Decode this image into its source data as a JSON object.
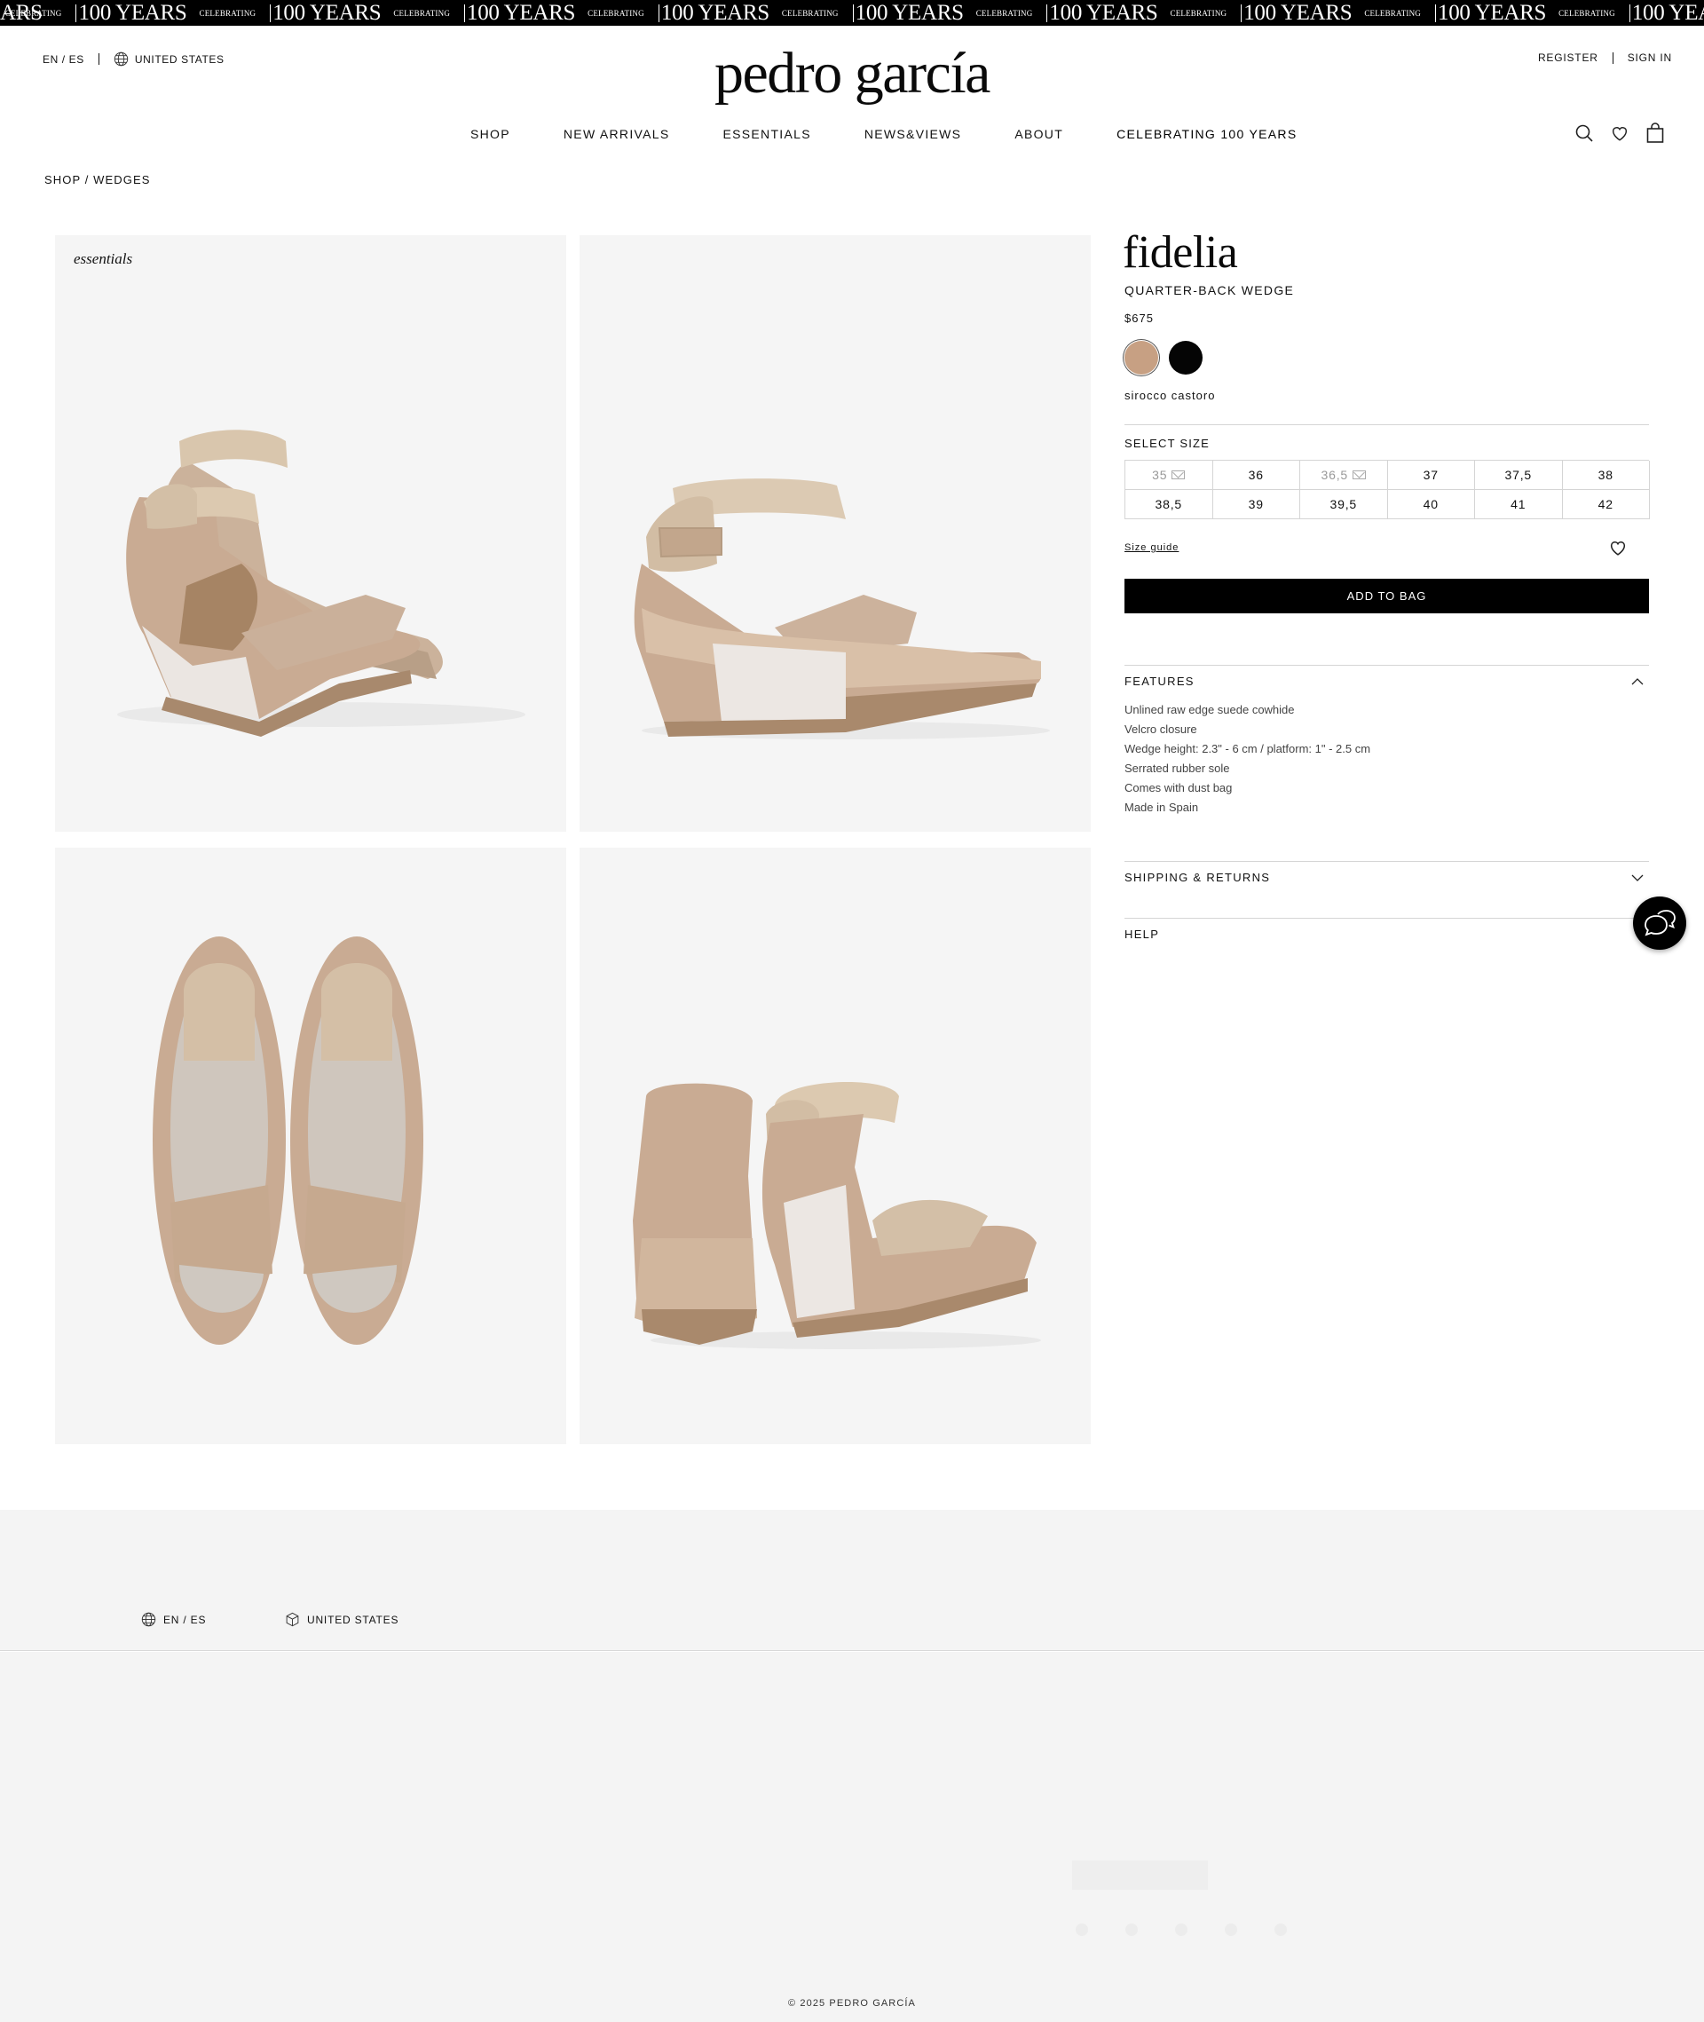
{
  "marquee": {
    "small": "CELEBRATING",
    "big": "100 YEARS",
    "lead": "ARS"
  },
  "header": {
    "language": "EN / ES",
    "country": "UNITED STATES",
    "logo": "pedro garcía",
    "register": "REGISTER",
    "sign_in": "SIGN IN",
    "icons": [
      "search-icon",
      "heart-icon",
      "bag-icon",
      "globe-icon"
    ]
  },
  "nav": [
    "SHOP",
    "NEW ARRIVALS",
    "ESSENTIALS",
    "NEWS&VIEWS",
    "ABOUT",
    "CELEBRATING 100 YEARS"
  ],
  "breadcrumb": "SHOP / WEDGES",
  "gallery": {
    "tag": "essentials",
    "images": [
      "wedge-pair-three-quarter",
      "wedge-side-profile",
      "wedge-top-view",
      "wedge-back-view"
    ]
  },
  "product": {
    "name": "fidelia",
    "subtitle": "QUARTER-BACK WEDGE",
    "price": "$675",
    "swatches": [
      {
        "name": "sirocco castoro",
        "color": "#c7a083",
        "selected": true
      },
      {
        "name": "black",
        "color": "#050505",
        "selected": false
      }
    ],
    "color_name": "sirocco castoro",
    "select_size_label": "SELECT SIZE",
    "sizes": [
      {
        "label": "35",
        "available": false
      },
      {
        "label": "36",
        "available": true
      },
      {
        "label": "36,5",
        "available": false
      },
      {
        "label": "37",
        "available": true
      },
      {
        "label": "37,5",
        "available": true
      },
      {
        "label": "38",
        "available": true
      },
      {
        "label": "38,5",
        "available": true
      },
      {
        "label": "39",
        "available": true
      },
      {
        "label": "39,5",
        "available": true
      },
      {
        "label": "40",
        "available": true
      },
      {
        "label": "41",
        "available": true
      },
      {
        "label": "42",
        "available": true
      }
    ],
    "size_guide": "Size guide",
    "add_to_bag": "ADD TO BAG"
  },
  "accordions": {
    "features": {
      "title": "FEATURES",
      "items": [
        "Unlined raw edge suede cowhide",
        "Velcro closure",
        "Wedge height: 2.3\" - 6 cm / platform: 1\" - 2.5 cm",
        "Serrated rubber sole",
        "Comes with dust bag",
        "Made in Spain"
      ]
    },
    "shipping": {
      "title": "SHIPPING & RETURNS"
    },
    "help": {
      "title": "HELP"
    }
  },
  "footer": {
    "language": "EN / ES",
    "country": "UNITED STATES",
    "copyright": "© 2025 PEDRO GARCÍA"
  },
  "colors": {
    "accent": "#000000",
    "suede": "#c9ab93",
    "gallery_bg": "#f5f5f5",
    "footer_bg": "#f4f4f4"
  }
}
